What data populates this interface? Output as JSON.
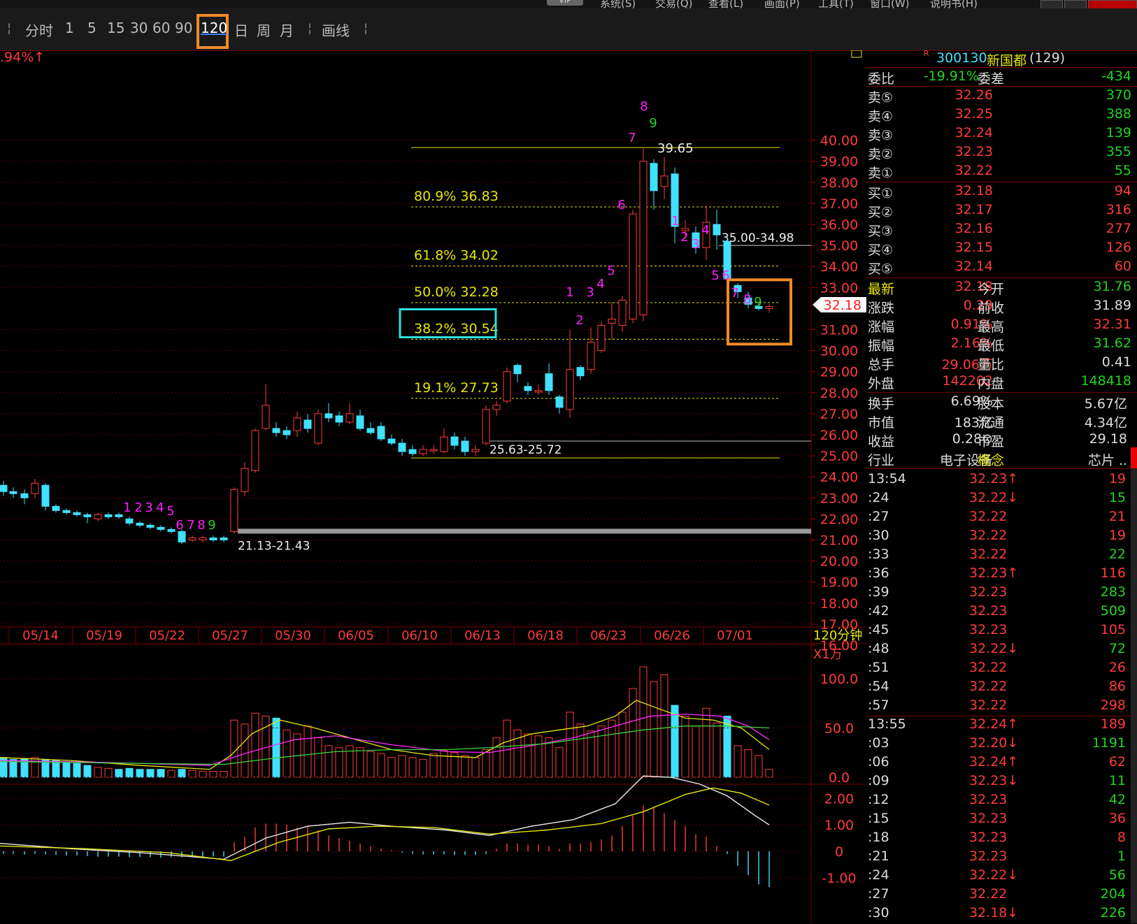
{
  "menu": {
    "vip": "VIP",
    "items": [
      "系统(S)",
      "交易(Q)",
      "查看(L)",
      "画面(P)",
      "工具(T)",
      "窗口(W)",
      "说明书(H)"
    ]
  },
  "toolbar": {
    "periods": [
      "分时",
      "1",
      "5",
      "15",
      "30",
      "60",
      "90",
      "120",
      "日",
      "周",
      "月"
    ],
    "selected_period": "120",
    "draw_tool": "画线"
  },
  "chart": {
    "corner_pct": ".94%↑",
    "period_label": "120分钟",
    "volume_unit": "X1万",
    "price_axis": [
      "40.00",
      "39.00",
      "38.00",
      "37.00",
      "36.00",
      "35.00",
      "34.00",
      "33.00",
      "31.00",
      "30.00",
      "29.00",
      "28.00",
      "27.00",
      "26.00",
      "25.00",
      "24.00",
      "23.00",
      "22.00",
      "21.00",
      "20.00",
      "19.00",
      "18.00",
      "17.00",
      "16.00"
    ],
    "current_price_tag": "32.18",
    "date_axis": [
      "05/14",
      "05/19",
      "05/22",
      "05/27",
      "05/30",
      "06/05",
      "06/10",
      "06/13",
      "06/18",
      "06/23",
      "06/26",
      "07/01"
    ],
    "volume_axis": [
      "100.0",
      "50.0",
      "0.0"
    ],
    "macd_axis": [
      "2.00",
      "1.00",
      "0",
      "-1.00"
    ],
    "fib_levels": [
      {
        "label": "80.9% 36.83",
        "price": 36.83
      },
      {
        "label": "61.8% 34.02",
        "price": 34.02
      },
      {
        "label": "50.0% 32.28",
        "price": 32.28
      },
      {
        "label": "38.2% 30.54",
        "price": 30.54
      },
      {
        "label": "19.1% 27.73",
        "price": 27.73
      }
    ],
    "annotations": {
      "high": "39.65",
      "zone_upper": "35.00-34.98",
      "zone_mid": "25.63-25.72",
      "zone_low": "21.13-21.43"
    },
    "sequence_marks": [
      "1",
      "2",
      "3",
      "4",
      "5",
      "6",
      "7",
      "8",
      "9"
    ]
  },
  "stock": {
    "code": "300130",
    "name": "新国都",
    "count": "(129)",
    "weibi_label": "委比",
    "weibi": "-19.91%",
    "weicha_label": "委差",
    "weicha": "-434",
    "sells": [
      {
        "label": "卖⑤",
        "price": "32.26",
        "vol": "370"
      },
      {
        "label": "卖④",
        "price": "32.25",
        "vol": "388"
      },
      {
        "label": "卖③",
        "price": "32.24",
        "vol": "139"
      },
      {
        "label": "卖②",
        "price": "32.23",
        "vol": "355"
      },
      {
        "label": "卖①",
        "price": "32.22",
        "vol": "55"
      }
    ],
    "buys": [
      {
        "label": "买①",
        "price": "32.18",
        "vol": "94"
      },
      {
        "label": "买②",
        "price": "32.17",
        "vol": "316"
      },
      {
        "label": "买③",
        "price": "32.16",
        "vol": "277"
      },
      {
        "label": "买④",
        "price": "32.15",
        "vol": "126"
      },
      {
        "label": "买⑤",
        "price": "32.14",
        "vol": "60"
      }
    ],
    "quote": [
      {
        "l1": "最新",
        "v1": "32.18",
        "c1": "red",
        "l2": "今开",
        "v2": "31.76",
        "c2": "green"
      },
      {
        "l1": "涨跌",
        "v1": "0.29",
        "c1": "red",
        "l2": "前收",
        "v2": "31.89",
        "c2": "lbl"
      },
      {
        "l1": "涨幅",
        "v1": "0.91%",
        "c1": "red",
        "l2": "最高",
        "v2": "32.31",
        "c2": "red"
      },
      {
        "l1": "振幅",
        "v1": "2.16%",
        "c1": "red",
        "l2": "最低",
        "v2": "31.62",
        "c2": "green"
      },
      {
        "l1": "总手",
        "v1": "29.06万",
        "c1": "red",
        "l2": "量比",
        "v2": "0.41",
        "c2": "lbl"
      },
      {
        "l1": "外盘",
        "v1": "142202",
        "c1": "red",
        "l2": "内盘",
        "v2": "148418",
        "c2": "green"
      }
    ],
    "info": [
      {
        "l1": "换手",
        "v1": "6.69%",
        "l2": "股本",
        "v2": "5.67亿"
      },
      {
        "l1": "市值",
        "v1": "183亿",
        "l2": "流通",
        "v2": "4.34亿"
      },
      {
        "l1": "收益",
        "v1": "0.28⊙",
        "l2": "市盈",
        "v2": "29.18"
      },
      {
        "l1": "行业",
        "v1": "电子设备",
        "l2": "概念",
        "v2": "芯片 .."
      }
    ],
    "ticks": [
      {
        "t": "13:54",
        "p": "32.23↑",
        "d": "up",
        "v": "19",
        "vc": "red"
      },
      {
        "t": ":24",
        "p": "32.22↓",
        "d": "down",
        "v": "15",
        "vc": "green"
      },
      {
        "t": ":27",
        "p": "32.22",
        "d": "",
        "v": "21",
        "vc": "red"
      },
      {
        "t": ":30",
        "p": "32.22",
        "d": "",
        "v": "19",
        "vc": "red"
      },
      {
        "t": ":33",
        "p": "32.22",
        "d": "",
        "v": "22",
        "vc": "green"
      },
      {
        "t": ":36",
        "p": "32.23↑",
        "d": "up",
        "v": "116",
        "vc": "red"
      },
      {
        "t": ":39",
        "p": "32.23",
        "d": "",
        "v": "283",
        "vc": "green"
      },
      {
        "t": ":42",
        "p": "32.23",
        "d": "",
        "v": "509",
        "vc": "green"
      },
      {
        "t": ":45",
        "p": "32.23",
        "d": "",
        "v": "105",
        "vc": "red"
      },
      {
        "t": ":48",
        "p": "32.22↓",
        "d": "down",
        "v": "72",
        "vc": "green"
      },
      {
        "t": ":51",
        "p": "32.22",
        "d": "",
        "v": "26",
        "vc": "red"
      },
      {
        "t": ":54",
        "p": "32.22",
        "d": "",
        "v": "86",
        "vc": "red"
      },
      {
        "t": ":57",
        "p": "32.22",
        "d": "",
        "v": "298",
        "vc": "red"
      },
      {
        "t": "13:55",
        "p": "32.24↑",
        "d": "up",
        "v": "189",
        "vc": "red"
      },
      {
        "t": ":03",
        "p": "32.20↓",
        "d": "down",
        "v": "1191",
        "vc": "green"
      },
      {
        "t": ":06",
        "p": "32.24↑",
        "d": "up",
        "v": "62",
        "vc": "red"
      },
      {
        "t": ":09",
        "p": "32.23↓",
        "d": "down",
        "v": "11",
        "vc": "green"
      },
      {
        "t": ":12",
        "p": "32.23",
        "d": "",
        "v": "42",
        "vc": "green"
      },
      {
        "t": ":15",
        "p": "32.23",
        "d": "",
        "v": "36",
        "vc": "red"
      },
      {
        "t": ":18",
        "p": "32.23",
        "d": "",
        "v": "8",
        "vc": "red"
      },
      {
        "t": ":21",
        "p": "32.23",
        "d": "",
        "v": "1",
        "vc": "green"
      },
      {
        "t": ":24",
        "p": "32.22↓",
        "d": "down",
        "v": "56",
        "vc": "green"
      },
      {
        "t": ":27",
        "p": "32.22",
        "d": "",
        "v": "204",
        "vc": "green"
      },
      {
        "t": ":30",
        "p": "32.18↓",
        "d": "down",
        "v": "226",
        "vc": "green"
      }
    ]
  },
  "colors": {
    "up": "#ff3b3b",
    "down": "#40e0ff",
    "fib": "#e6e60a",
    "highlight_orange": "#f08a2a",
    "highlight_cyan": "#2ee0e0",
    "grid": "#5a0000"
  }
}
